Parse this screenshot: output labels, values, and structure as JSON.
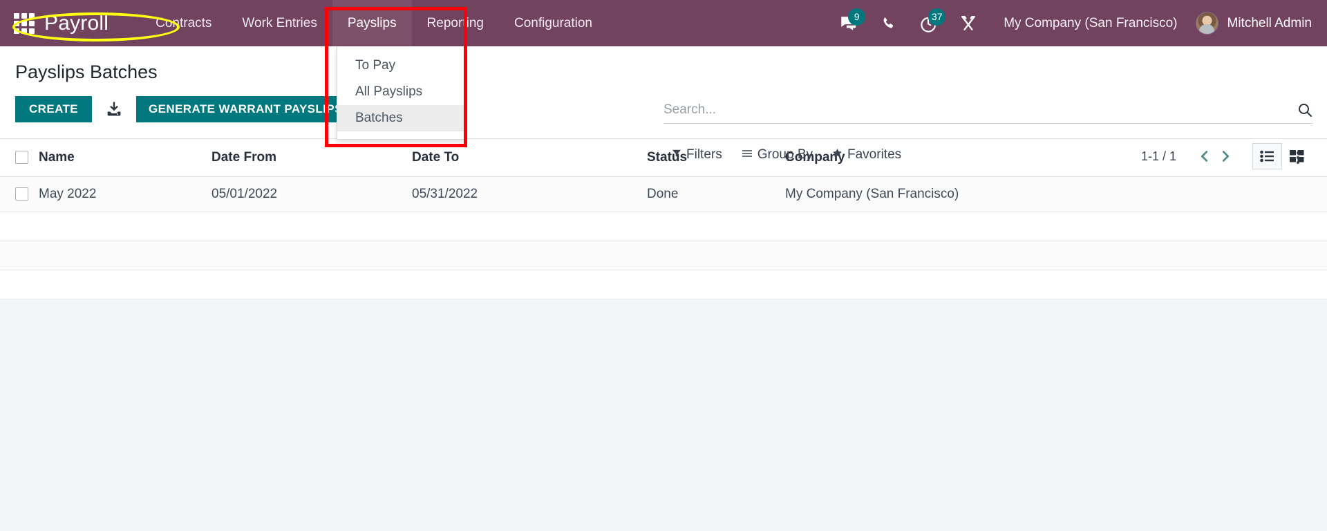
{
  "navbar": {
    "apps_icon": "apps-grid-icon",
    "brand": "Payroll",
    "menu": [
      {
        "label": "Contracts",
        "active": false
      },
      {
        "label": "Work Entries",
        "active": false
      },
      {
        "label": "Payslips",
        "active": true
      },
      {
        "label": "Reporting",
        "active": false
      },
      {
        "label": "Configuration",
        "active": false
      }
    ],
    "messages_badge": "9",
    "activities_badge": "37",
    "company": "My Company (San Francisco)",
    "user": "Mitchell Admin",
    "bg_color": "#71435f",
    "accent_color": "#00787e"
  },
  "dropdown": {
    "items": [
      {
        "label": "To Pay",
        "highlighted": false
      },
      {
        "label": "All Payslips",
        "highlighted": false
      },
      {
        "label": "Batches",
        "highlighted": true
      }
    ]
  },
  "annotations": {
    "rect_color": "#fb0007",
    "ellipse_color": "#ffff12"
  },
  "control_panel": {
    "breadcrumb": "Payslips Batches",
    "create_label": "CREATE",
    "import_icon": "import-download-icon",
    "generate_label": "GENERATE WARRANT PAYSLIPS",
    "search_placeholder": "Search...",
    "search_value": "",
    "search_icon": "search-icon",
    "facets": [
      {
        "label": "Filters",
        "icon": "filter-icon"
      },
      {
        "label": "Group By",
        "icon": "group-by-icon"
      },
      {
        "label": "Favorites",
        "icon": "star-icon"
      }
    ],
    "pager": "1-1 / 1",
    "prev_icon": "chevron-left-icon",
    "next_icon": "chevron-right-icon",
    "views": [
      {
        "name": "list-view",
        "icon": "list-icon",
        "active": true
      },
      {
        "name": "kanban-view",
        "icon": "kanban-icon",
        "active": false
      }
    ]
  },
  "table": {
    "columns": [
      "Name",
      "Date From",
      "Date To",
      "Status",
      "Company"
    ],
    "rows": [
      {
        "name": "May 2022",
        "date_from": "05/01/2022",
        "date_to": "05/31/2022",
        "status": "Done",
        "company": "My Company (San Francisco)"
      }
    ],
    "empty_row_count": 3,
    "options_icon": "vertical-dots-icon"
  }
}
